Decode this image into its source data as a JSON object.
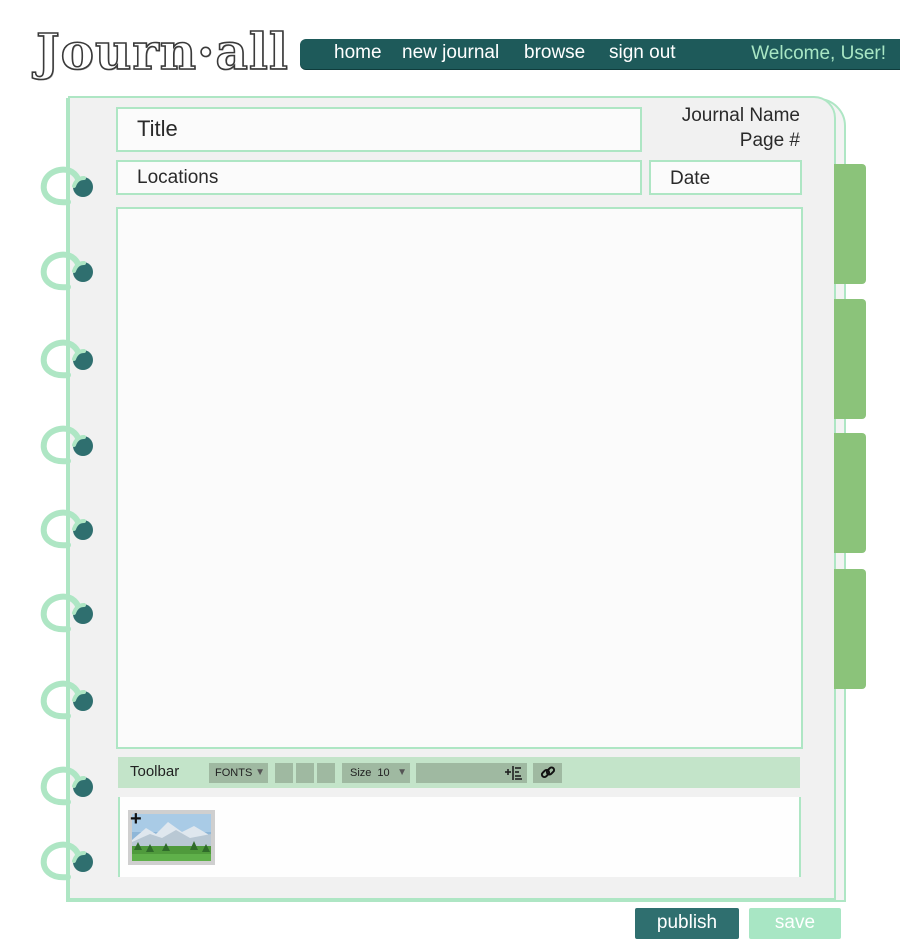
{
  "app": {
    "logo_text": "Journ·all"
  },
  "nav": {
    "items": [
      {
        "label": "home"
      },
      {
        "label": "new journal"
      },
      {
        "label": "browse"
      },
      {
        "label": "sign out"
      }
    ],
    "welcome": "Welcome, User!"
  },
  "entry": {
    "title_placeholder": "Title",
    "locations_placeholder": "Locations",
    "date_placeholder": "Date",
    "journal_name": "Journal Name",
    "page_number": "Page #",
    "body": ""
  },
  "toolbar": {
    "label": "Toolbar",
    "fonts_label": "FONTS",
    "size_label": "Size",
    "size_value": "10",
    "icons": [
      "dropdown-caret-icon",
      "indent-icon",
      "link-icon"
    ]
  },
  "attachments": {
    "items": [
      {
        "type": "image",
        "icon": "add-icon",
        "scene": "landscape-thumbnail"
      }
    ]
  },
  "actions": {
    "publish_label": "publish",
    "save_label": "save"
  },
  "colors": {
    "nav_bg": "#1e5a5a",
    "accent_light": "#aee6c4",
    "tab_green": "#8bc37a",
    "toolbar_bg": "#c3e4c9",
    "publish_bg": "#2f6f6f",
    "save_bg": "#a8e6c4",
    "welcome_text": "#a8e6c4"
  }
}
